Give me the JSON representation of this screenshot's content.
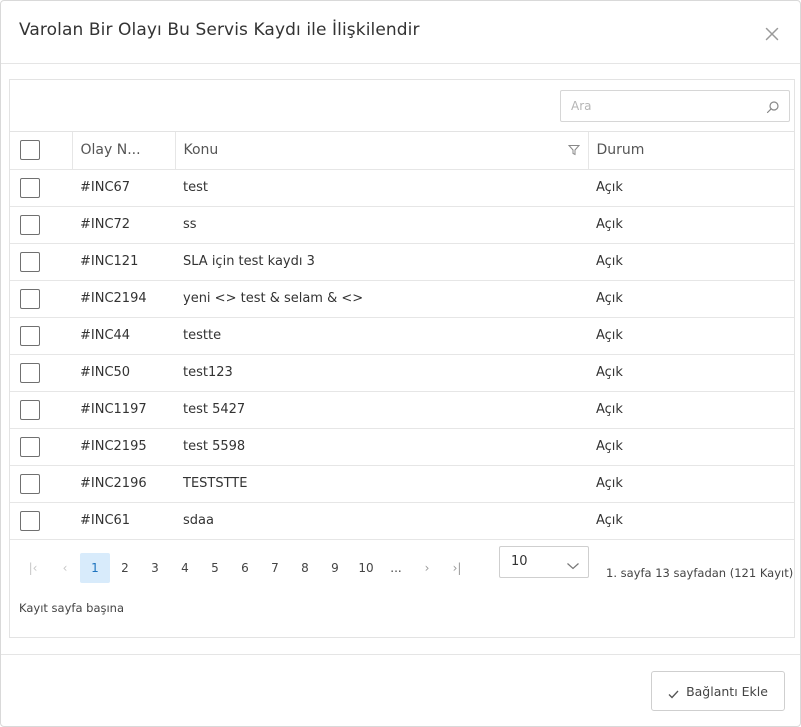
{
  "dialog": {
    "title": "Varolan Bir Olayı Bu Servis Kaydı ile İlişkilendir"
  },
  "search": {
    "placeholder": "Ara",
    "icon": "search-icon"
  },
  "table": {
    "columns": {
      "number": "Olay N...",
      "subject": "Konu",
      "status": "Durum"
    },
    "rows": [
      {
        "number": "#INC67",
        "subject": "test",
        "status": "Açık"
      },
      {
        "number": "#INC72",
        "subject": "ss",
        "status": "Açık"
      },
      {
        "number": "#INC121",
        "subject": "SLA için test kaydı 3",
        "status": "Açık"
      },
      {
        "number": "#INC2194",
        "subject": "yeni <> test & selam & <>",
        "status": "Açık"
      },
      {
        "number": "#INC44",
        "subject": "testte",
        "status": "Açık"
      },
      {
        "number": "#INC50",
        "subject": "test123",
        "status": "Açık"
      },
      {
        "number": "#INC1197",
        "subject": "test 5427",
        "status": "Açık"
      },
      {
        "number": "#INC2195",
        "subject": "test 5598",
        "status": "Açık"
      },
      {
        "number": "#INC2196",
        "subject": "TESTSTTE",
        "status": "Açık"
      },
      {
        "number": "#INC61",
        "subject": "sdaa",
        "status": "Açık"
      }
    ]
  },
  "pager": {
    "first": "|‹",
    "prev": "‹",
    "next": "›",
    "last": "›|",
    "pages": [
      "1",
      "2",
      "3",
      "4",
      "5",
      "6",
      "7",
      "8",
      "9",
      "10",
      "..."
    ],
    "current_page": "1",
    "page_size": "10",
    "info": "1. sayfa 13 sayfadan (121 Kayıt)",
    "per_page_label": "Kayıt sayfa başına"
  },
  "footer": {
    "link_button": "Bağlantı Ekle"
  },
  "colors": {
    "active_page_bg": "#d8ebfb",
    "active_page_text": "#1e73be"
  }
}
